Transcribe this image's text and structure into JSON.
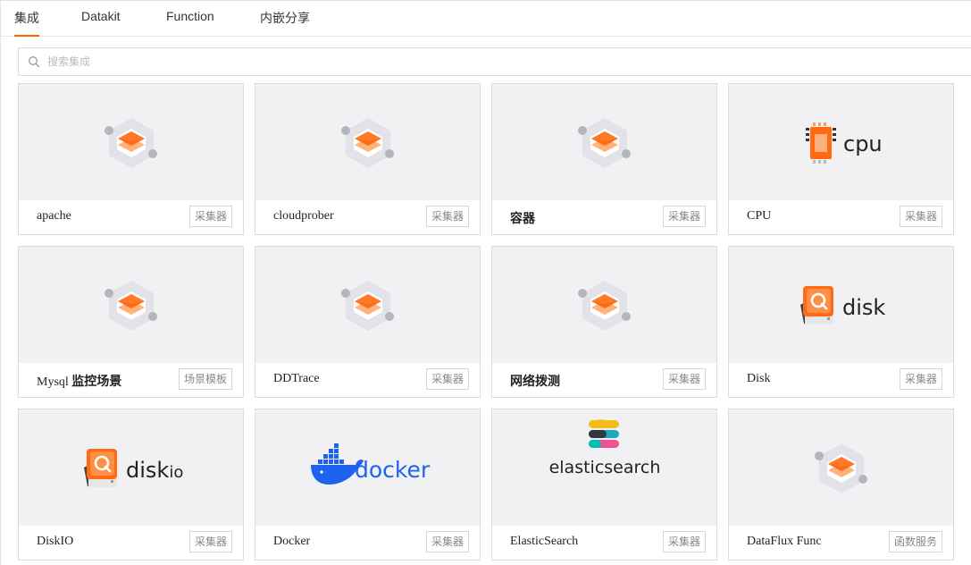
{
  "tabs": [
    {
      "label": "集成",
      "active": true
    },
    {
      "label": "Datakit",
      "active": false
    },
    {
      "label": "Function",
      "active": false
    },
    {
      "label": "内嵌分享",
      "active": false
    }
  ],
  "search": {
    "placeholder": "搜索集成",
    "value": ""
  },
  "cards": [
    {
      "title": "apache",
      "badge": "采集器",
      "logo": "default-hex-icon"
    },
    {
      "title": "cloudprober",
      "badge": "采集器",
      "logo": "default-hex-icon"
    },
    {
      "title": "容器",
      "badge": "采集器",
      "logo": "default-hex-icon"
    },
    {
      "title": "CPU",
      "badge": "采集器",
      "logo": "cpu-logo",
      "logo_text": "cpu"
    },
    {
      "title": "Mysql 监控场景",
      "badge": "场景模板",
      "logo": "default-hex-icon"
    },
    {
      "title": "DDTrace",
      "badge": "采集器",
      "logo": "default-hex-icon"
    },
    {
      "title": "网络拨测",
      "badge": "采集器",
      "logo": "default-hex-icon"
    },
    {
      "title": "Disk",
      "badge": "采集器",
      "logo": "disk-logo",
      "logo_text": "disk"
    },
    {
      "title": "DiskIO",
      "badge": "采集器",
      "logo": "diskio-logo",
      "logo_text": "disk",
      "logo_suffix": "io"
    },
    {
      "title": "Docker",
      "badge": "采集器",
      "logo": "docker-logo",
      "logo_text": "docker"
    },
    {
      "title": "ElasticSearch",
      "badge": "采集器",
      "logo": "elasticsearch-logo",
      "logo_text": "elasticsearch"
    },
    {
      "title": "DataFlux Func",
      "badge": "函数服务",
      "logo": "default-hex-icon"
    }
  ],
  "colors": {
    "accent": "#ff6600",
    "docker_blue": "#1d63ed",
    "card_bg": "#f1f1f4"
  }
}
